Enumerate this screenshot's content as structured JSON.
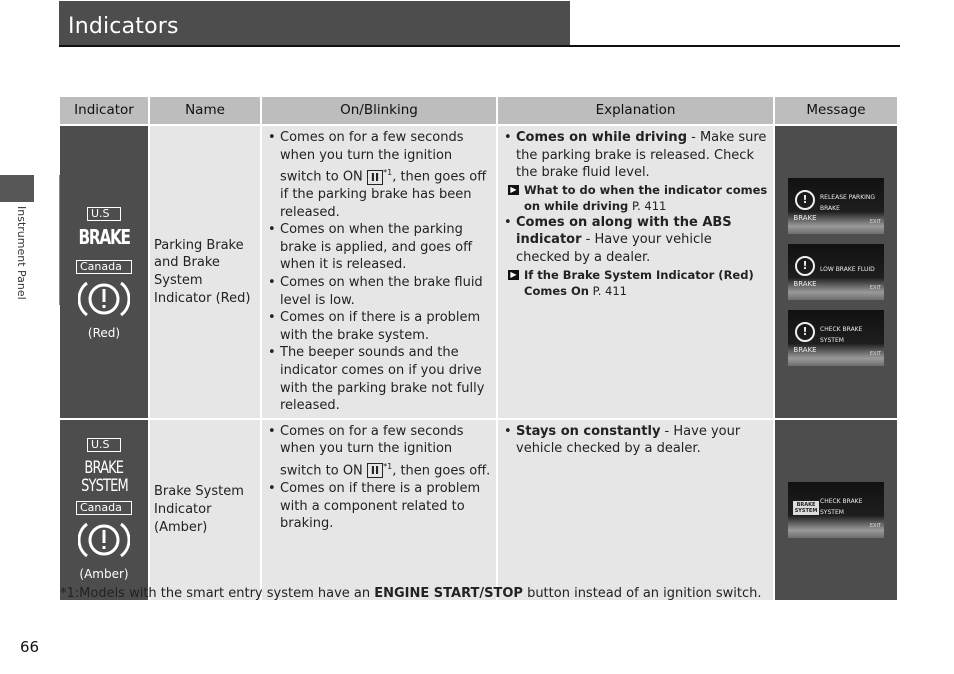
{
  "header": {
    "title": "Indicators"
  },
  "side_tab": {
    "label": "Instrument Panel"
  },
  "table": {
    "columns": [
      "Indicator",
      "Name",
      "On/Blinking",
      "Explanation",
      "Message"
    ],
    "rows": [
      {
        "indicator": {
          "us_label": "U.S",
          "us_symbol": "BRAKE",
          "canada_label": "Canada",
          "canada_symbol": "(!)",
          "color_note": "(Red)"
        },
        "name": "Parking Brake and Brake System Indicator (Red)",
        "on_blinking": [
          {
            "pre": "Comes on for a few seconds when you turn the ignition switch to ON ",
            "ignition": "II",
            "footnote": "*1",
            "post": ", then goes off if the parking brake has been released."
          },
          {
            "text": "Comes on when the parking brake is applied, and goes off when it is released."
          },
          {
            "text": "Comes on when the brake fluid level is low."
          },
          {
            "text": "Comes on if there is a problem with the brake system."
          },
          {
            "text": "The beeper sounds and the indicator comes on if you drive with the parking brake not fully released."
          }
        ],
        "explanation": [
          {
            "bold": "Comes on while driving",
            "text": " - Make sure the parking brake is released. Check the brake fluid level.",
            "xref": {
              "bold": "What to do when the indicator comes on while driving",
              "page": " P. 411"
            }
          },
          {
            "bold": "Comes on along with the ABS indicator",
            "text": " - Have your vehicle checked by a dealer.",
            "xref": {
              "bold": "If the Brake System Indicator (Red) Comes On",
              "page": " P. 411"
            }
          }
        ],
        "messages": [
          {
            "icon_label": "BRAKE",
            "line1": "RELEASE PARKING",
            "line2": "BRAKE",
            "exit": "EXIT"
          },
          {
            "icon_label": "BRAKE",
            "line1": "LOW BRAKE FLUID",
            "line2": "",
            "exit": "EXIT"
          },
          {
            "icon_label": "BRAKE",
            "line1": "CHECK BRAKE",
            "line2": "SYSTEM",
            "exit": "EXIT"
          }
        ]
      },
      {
        "indicator": {
          "us_label": "U.S",
          "us_symbol_line1": "BRAKE",
          "us_symbol_line2": "SYSTEM",
          "canada_label": "Canada",
          "canada_symbol": "(!)",
          "color_note": "(Amber)"
        },
        "name": "Brake System Indicator (Amber)",
        "on_blinking": [
          {
            "pre": "Comes on for a few seconds when you turn the ignition switch to ON ",
            "ignition": "II",
            "footnote": "*1",
            "post": ", then goes off."
          },
          {
            "text": "Comes on if there is a problem with a component related to braking."
          }
        ],
        "explanation": [
          {
            "bold": "Stays on constantly",
            "text": " - Have your vehicle checked by a dealer."
          }
        ],
        "messages": [
          {
            "badge_line1": "BRAKE",
            "badge_line2": "SYSTEM",
            "line1": "CHECK BRAKE",
            "line2": "SYSTEM",
            "exit": "EXIT"
          }
        ]
      }
    ]
  },
  "footnote": {
    "pre": "*1:Models with the smart entry system have an ",
    "bold": "ENGINE START/STOP",
    "post": " button instead of an ignition switch."
  },
  "page_number": "66",
  "colors": {
    "header_bg": "#4d4d4d",
    "table_header_bg": "#bdbdbd",
    "cell_bg": "#e6e6e6",
    "icon_cell_bg": "#4d4d4d"
  }
}
